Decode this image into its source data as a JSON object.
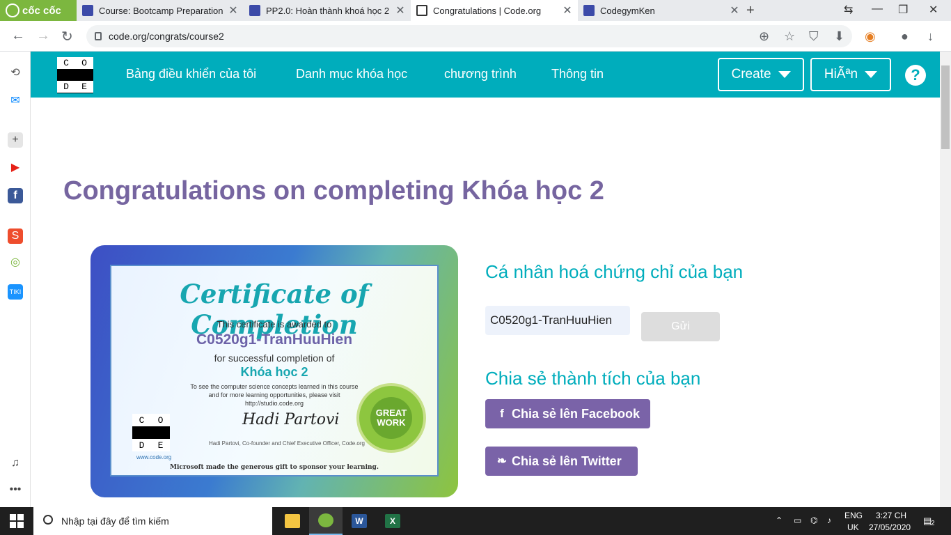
{
  "browser": {
    "brand": "cốc cốc",
    "tabs": [
      {
        "title": "Course: Bootcamp Preparation",
        "favicon": "codegym-icon"
      },
      {
        "title": "PP2.0: Hoàn thành khoá học 2",
        "favicon": "codegym-icon"
      },
      {
        "title": "Congratulations | Code.org",
        "favicon": "code-org-icon",
        "active": true
      },
      {
        "title": "CodegymKen",
        "favicon": "codegym-icon"
      }
    ],
    "url": "code.org/congrats/course2"
  },
  "header": {
    "logo_letters": [
      "C",
      "O",
      "D",
      "E"
    ],
    "nav": [
      "Bảng điều khiển của tôi",
      "Danh mục khóa học",
      "chương trình",
      "Thông tin"
    ],
    "create_label": "Create",
    "user_label": "HiÃªn",
    "help": "?"
  },
  "main": {
    "title": "Congratulations on completing Khóa học 2",
    "certificate": {
      "title": "Certificate of Completion",
      "awarded_to": "This certificate is awarded to",
      "name": "C0520g1-TranHuuHien",
      "for_completion": "for successful completion of",
      "course": "Khóa học 2",
      "concepts_line1": "To see the computer science concepts learned in this course",
      "concepts_line2": "and for more learning opportunities, please visit",
      "concepts_url": "http://studio.code.org",
      "signature": "Hadi Partovi",
      "signer": "Hadi Partovi, Co-founder and Chief Executive Officer, Code.org",
      "website": "www.code.org",
      "sponsor": "Microsoft made the generous gift to sponsor your learning.",
      "badge_text": "GREAT WORK"
    },
    "personalize_heading": "Cá nhân hoá chứng chỉ của bạn",
    "name_value": "C0520g1-TranHuuHien",
    "submit_label": "Gửi",
    "share_heading": "Chia sẻ thành tích của bạn",
    "share_facebook": "Chia sẻ lên Facebook",
    "share_twitter": "Chia sẻ lên Twitter"
  },
  "taskbar": {
    "search_placeholder": "Nhập tại đây để tìm kiếm",
    "lang_top": "ENG",
    "lang_bottom": "UK",
    "time": "3:27 CH",
    "date": "27/05/2020",
    "notifications": "2"
  }
}
